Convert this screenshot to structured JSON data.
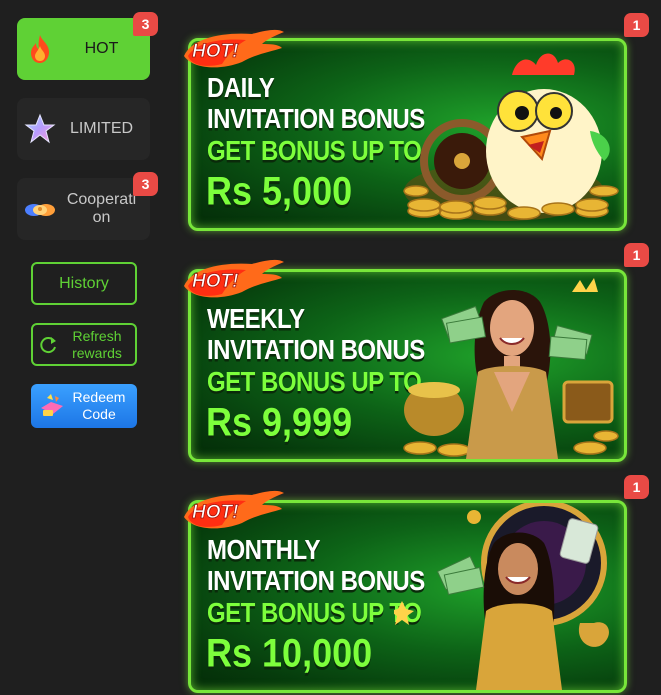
{
  "sidebar": {
    "tabs": [
      {
        "label": "HOT",
        "badge": "3",
        "icon": "fire-icon",
        "active": true
      },
      {
        "label": "LIMITED",
        "badge": "",
        "icon": "star-icon",
        "active": false
      },
      {
        "label": "Cooperati\non",
        "badge": "3",
        "icon": "handshake-icon",
        "active": false
      }
    ],
    "history_label": "History",
    "refresh_label": "Refresh rewards",
    "redeem_label": "Redeem Code"
  },
  "banners": [
    {
      "tag": "HOT!",
      "line1": "DAILY",
      "line2": "INVITATION BONUS",
      "line3": "GET BONUS UP TO",
      "amount": "Rs 5,000",
      "badge": "1",
      "art": "rooster-mascot-with-coins"
    },
    {
      "tag": "HOT!",
      "line1": "WEEKLY",
      "line2": "INVITATION BONUS",
      "line3": "GET BONUS UP TO",
      "amount": "Rs 9,999",
      "badge": "1",
      "art": "woman-with-cash-and-gold"
    },
    {
      "tag": "HOT!",
      "line1": "MONTHLY",
      "line2": "INVITATION BONUS",
      "line3": "GET BONUS UP TO",
      "amount": "Rs 10,000",
      "badge": "1",
      "art": "woman-with-cash-and-roulette"
    }
  ],
  "colors": {
    "accent": "#5fd135",
    "badge": "#e94a45",
    "banner_glow": "#78e63a",
    "amount_green": "#7dff3c",
    "background": "#1f1f1f"
  }
}
